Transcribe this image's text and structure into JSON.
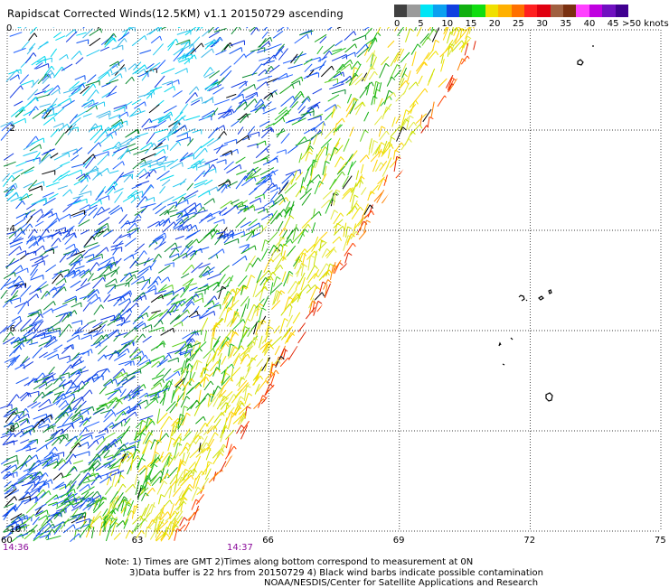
{
  "title": "Rapidscat Corrected Winds(12.5KM) v1.1 20150729 ascending",
  "colorbar": {
    "labels": [
      "0",
      "5",
      "10",
      "15",
      "20",
      "25",
      "30",
      "35",
      "40",
      "45"
    ],
    "units": ">50 knots",
    "colors": [
      "#404040",
      "#9a9a9a",
      "#00e5f5",
      "#0aa0f0",
      "#1040e0",
      "#10b010",
      "#10dd10",
      "#f0e000",
      "#ffb000",
      "#ff7000",
      "#ff2020",
      "#e00010",
      "#a06040",
      "#7a3010",
      "#ff40ff",
      "#c000e0",
      "#7010c0",
      "#400090"
    ]
  },
  "lon_labels": [
    "60",
    "63",
    "66",
    "69",
    "72",
    "75"
  ],
  "lat_labels": [
    "0",
    "-2",
    "-4",
    "-6",
    "-8",
    "-10"
  ],
  "times": {
    "left": "14:36",
    "mid": "14:37"
  },
  "notes": {
    "line1": "Note: 1) Times are GMT 2)Times along bottom correspond to measurement at 0N",
    "line2": "3)Data buffer is 22 hrs from 20150729 4) Black wind barbs indicate possible contamination",
    "line3": "NOAA/NESDIS/Center for Satellite Applications and Research"
  },
  "swath_legend": {
    "speed_bins_knots": [
      0,
      5,
      10,
      15,
      20,
      25,
      30,
      35,
      40,
      45,
      50
    ]
  }
}
